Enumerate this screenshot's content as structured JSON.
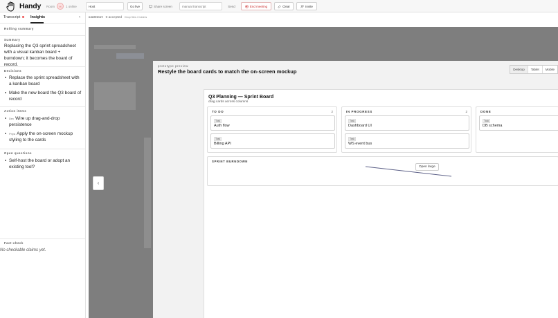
{
  "app": {
    "brand": "Handy"
  },
  "header": {
    "room_label": "Room",
    "avatar_initial": "H",
    "presence": "1 online",
    "name_value": "Host",
    "go_live": "Go live",
    "share_screen": "Share screen",
    "transcript_placeholder": "manual transcript",
    "send": "Send",
    "end_meeting": "End meeting",
    "clear": "Clear",
    "invite": "Invite"
  },
  "left": {
    "tabs": [
      {
        "label": "Transcript"
      },
      {
        "label": "Insights"
      }
    ],
    "rolling_summary": "Rolling summary",
    "summary": {
      "heading": "Summary",
      "text": "Replacing the Q3 sprint spreadsheet with a visual kanban board + burndown; it becomes the board of record."
    },
    "decisions": {
      "heading": "Decisions",
      "items": [
        "Replace the sprint spreadsheet with a kanban board",
        "Make the new board the Q3 board of record"
      ]
    },
    "action_items": {
      "heading": "Action items",
      "items": [
        {
          "owner": "Dev",
          "text": "Wire up drag-and-drop persistence"
        },
        {
          "owner": "Priya",
          "text": "Apply the on-screen mockup styling to the cards"
        }
      ]
    },
    "open_questions": {
      "heading": "Open questions",
      "items": [
        "Self-host the board or adopt an existing tool?"
      ]
    },
    "fact_check": {
      "heading": "Fact-check",
      "text": "No checkable claims yet."
    }
  },
  "main": {
    "context_label": "context",
    "accepted": "0 accepted",
    "drop_hint": "Drop files / folders",
    "preview": {
      "label": "prototype preview",
      "title": "Restyle the board cards to match the on-screen mockup",
      "devices": [
        "Desktop",
        "Tablet",
        "Mobile"
      ]
    },
    "board": {
      "title": "Q3 Planning — Sprint Board",
      "subtitle": "drag cards across columns",
      "columns": [
        {
          "name": "TO DO",
          "count": "2",
          "cards": [
            {
              "tag": "Task",
              "name": "Auth flow"
            },
            {
              "tag": "Task",
              "name": "Billing API"
            }
          ]
        },
        {
          "name": "IN PROGRESS",
          "count": "2",
          "cards": [
            {
              "tag": "Task",
              "name": "Dashboard UI"
            },
            {
              "tag": "Task",
              "name": "WS event bus"
            }
          ]
        },
        {
          "name": "DONE",
          "count": "",
          "cards": [
            {
              "tag": "Task",
              "name": "DB schema"
            }
          ]
        }
      ],
      "burndown_title": "SPRINT BURNDOWN",
      "open_large": "Open large"
    }
  },
  "colors": {
    "accent": "#e55555",
    "canvas": "#7e7e7e"
  }
}
